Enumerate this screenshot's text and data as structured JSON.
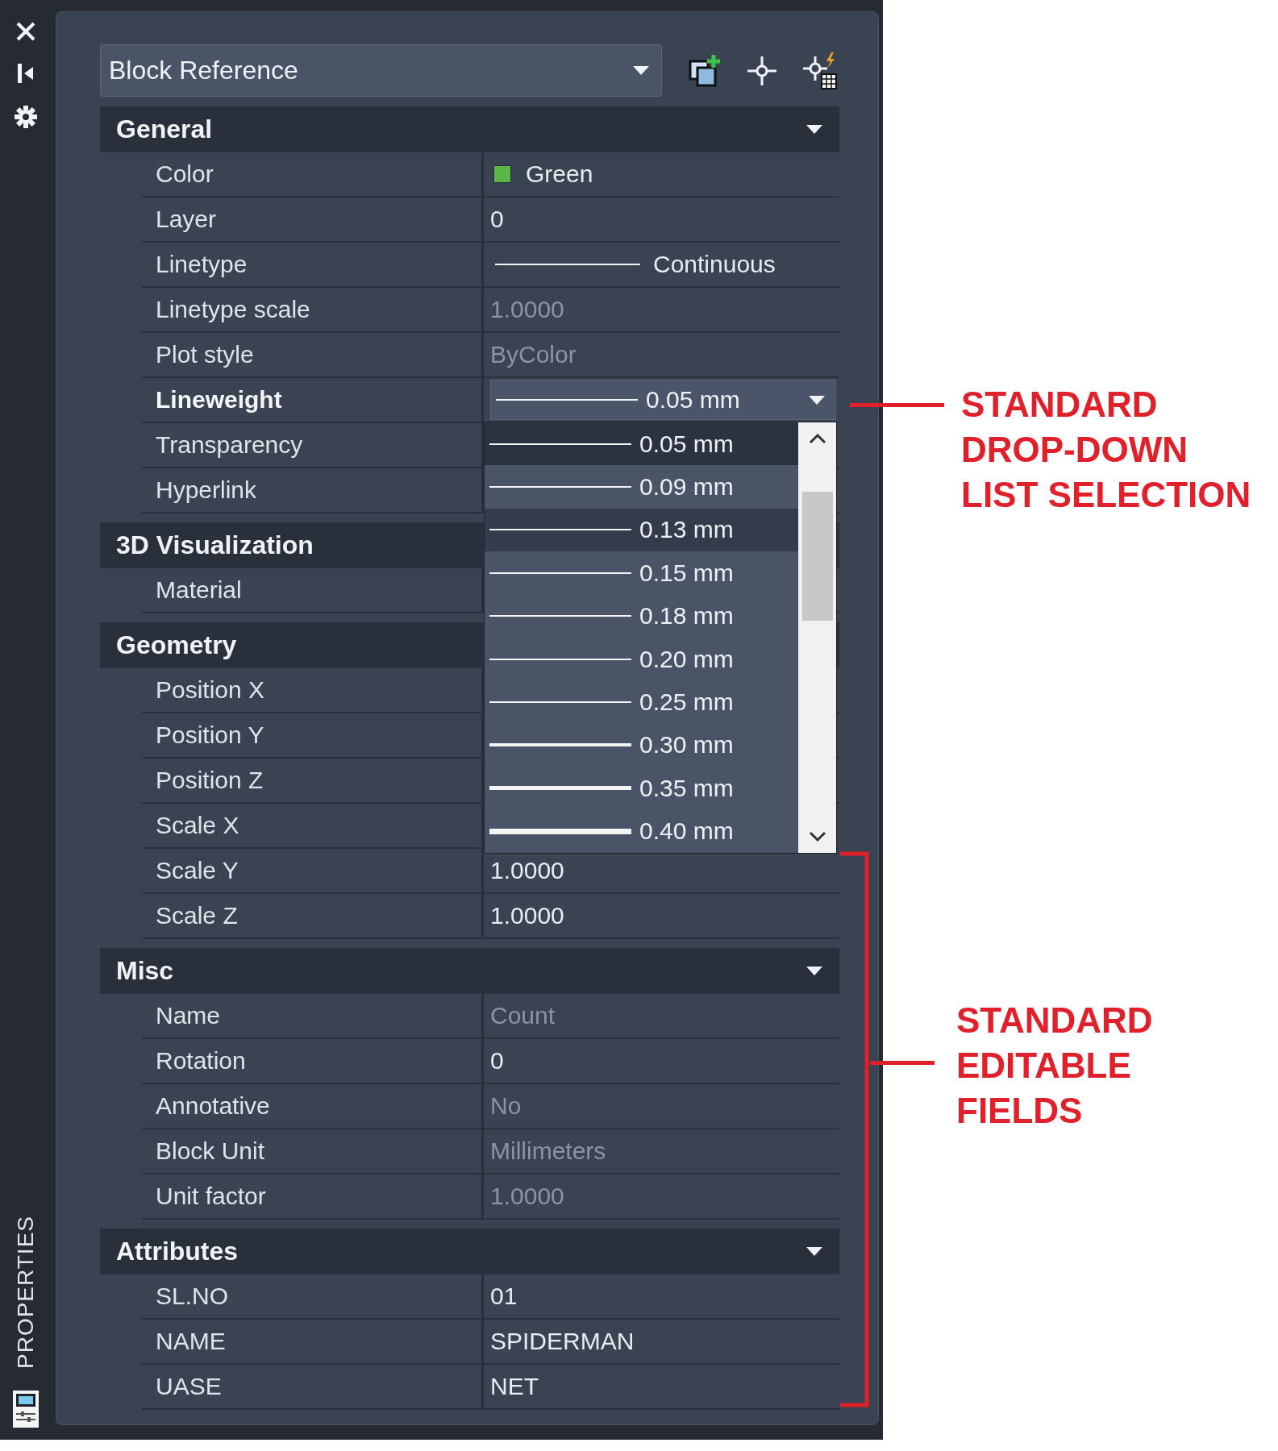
{
  "side_tab": {
    "label": "PROPERTIES"
  },
  "object_selector": {
    "value": "Block Reference"
  },
  "sections": [
    {
      "title": "General",
      "expanded": true,
      "rows": [
        {
          "label": "Color",
          "selected": false,
          "kind": "swatch",
          "value": "Green",
          "color": "#5cb648",
          "disabled": false
        },
        {
          "label": "Layer",
          "selected": false,
          "kind": "text",
          "value": "0",
          "disabled": false
        },
        {
          "label": "Linetype",
          "selected": false,
          "kind": "linetype",
          "value": "Continuous",
          "disabled": false
        },
        {
          "label": "Linetype scale",
          "selected": false,
          "kind": "text",
          "value": "1.0000",
          "disabled": true
        },
        {
          "label": "Plot style",
          "selected": false,
          "kind": "text",
          "value": "ByColor",
          "disabled": true
        },
        {
          "label": "Lineweight",
          "selected": true,
          "kind": "dropdown",
          "value": "0.05 mm",
          "disabled": false,
          "options": [
            {
              "label": "0.05 mm",
              "kind": "thin",
              "selected": true,
              "highlighted": false
            },
            {
              "label": "0.09 mm",
              "kind": "thin",
              "selected": false,
              "highlighted": false
            },
            {
              "label": "0.13 mm",
              "kind": "thin",
              "selected": false,
              "highlighted": true
            },
            {
              "label": "0.15 mm",
              "kind": "thin",
              "selected": false,
              "highlighted": false
            },
            {
              "label": "0.18 mm",
              "kind": "thin",
              "selected": false,
              "highlighted": false
            },
            {
              "label": "0.20 mm",
              "kind": "thin",
              "selected": false,
              "highlighted": false
            },
            {
              "label": "0.25 mm",
              "kind": "thin",
              "selected": false,
              "highlighted": false
            },
            {
              "label": "0.30 mm",
              "kind": "medium",
              "selected": false,
              "highlighted": false
            },
            {
              "label": "0.35 mm",
              "kind": "bold",
              "selected": false,
              "highlighted": false
            },
            {
              "label": "0.40 mm",
              "kind": "heavy",
              "selected": false,
              "highlighted": false
            }
          ]
        },
        {
          "label": "Transparency",
          "selected": false
        },
        {
          "label": "Hyperlink",
          "selected": false
        }
      ]
    },
    {
      "title": "3D Visualization",
      "rows": [
        {
          "label": "Material",
          "selected": false
        }
      ]
    },
    {
      "title": "Geometry",
      "rows": [
        {
          "label": "Position X",
          "selected": false
        },
        {
          "label": "Position Y",
          "selected": false
        },
        {
          "label": "Position Z",
          "selected": false
        },
        {
          "label": "Scale X",
          "selected": false
        },
        {
          "label": "Scale Y",
          "selected": false,
          "kind": "text",
          "value": "1.0000",
          "disabled": false
        },
        {
          "label": "Scale Z",
          "selected": false,
          "kind": "text",
          "value": "1.0000",
          "disabled": false
        }
      ]
    },
    {
      "title": "Misc",
      "expanded": true,
      "rows": [
        {
          "label": "Name",
          "selected": false,
          "kind": "text",
          "value": "Count",
          "disabled": true
        },
        {
          "label": "Rotation",
          "selected": false,
          "kind": "text",
          "value": "0",
          "disabled": false
        },
        {
          "label": "Annotative",
          "selected": false,
          "kind": "text",
          "value": "No",
          "disabled": true
        },
        {
          "label": "Block Unit",
          "selected": false,
          "kind": "text",
          "value": "Millimeters",
          "disabled": true
        },
        {
          "label": "Unit factor",
          "selected": false,
          "kind": "text",
          "value": "1.0000",
          "disabled": true
        }
      ]
    },
    {
      "title": "Attributes",
      "expanded": true,
      "rows": [
        {
          "label": "SL.NO",
          "selected": false,
          "kind": "text",
          "value": "01",
          "disabled": false
        },
        {
          "label": "NAME",
          "selected": false,
          "kind": "text",
          "value": "SPIDERMAN",
          "disabled": false
        },
        {
          "label": "UASE",
          "selected": false,
          "kind": "text",
          "value": "NET",
          "disabled": false
        }
      ]
    }
  ],
  "callouts": [
    {
      "kind": "pointer",
      "lines": [
        "STANDARD",
        "DROP-DOWN",
        "LIST SELECTION"
      ]
    },
    {
      "kind": "bracket",
      "lines": [
        "STANDARD",
        "EDITABLE",
        "FIELDS"
      ]
    }
  ]
}
